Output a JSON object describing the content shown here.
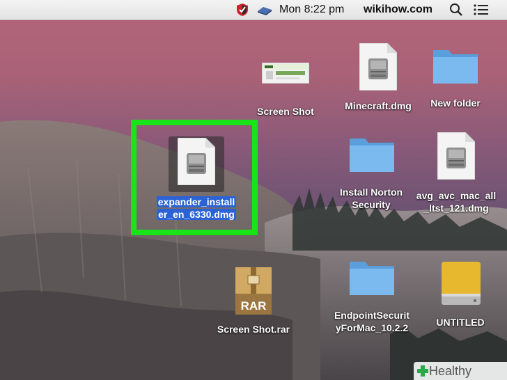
{
  "menubar": {
    "clock": "Mon 8:22 pm",
    "site": "wikihow.com",
    "icons": [
      "norton-shield-icon",
      "usb-drive-icon",
      "spotlight-search-icon",
      "notification-list-icon"
    ]
  },
  "desktop": {
    "selected_file": {
      "label": "expander_installer_en_6330.dmg",
      "line1": "expander_install",
      "line2": "er_en_6330.dmg",
      "icon": "dmg-disk-image-icon"
    },
    "items": {
      "screen_shot": "Screen Shot",
      "minecraft": "Minecraft.dmg",
      "new_folder": "New folder",
      "install_norton_1": "Install Norton",
      "install_norton_2": "Security",
      "avg_1": "avg_avc_mac_all",
      "avg_2": "_ltst_121.dmg",
      "rar": "Screen Shot.rar",
      "rar_badge": "RAR",
      "endpoint_1": "EndpointSecurit",
      "endpoint_2": "yForMac_10.2.2",
      "untitled": "UNTITLED"
    },
    "highlight_color": "#19e319",
    "selection_color": "#2b63d6",
    "folder_color": "#6fb1e8"
  },
  "watermark": {
    "text": "Healthy Living",
    "accent": "#2aa84a"
  }
}
